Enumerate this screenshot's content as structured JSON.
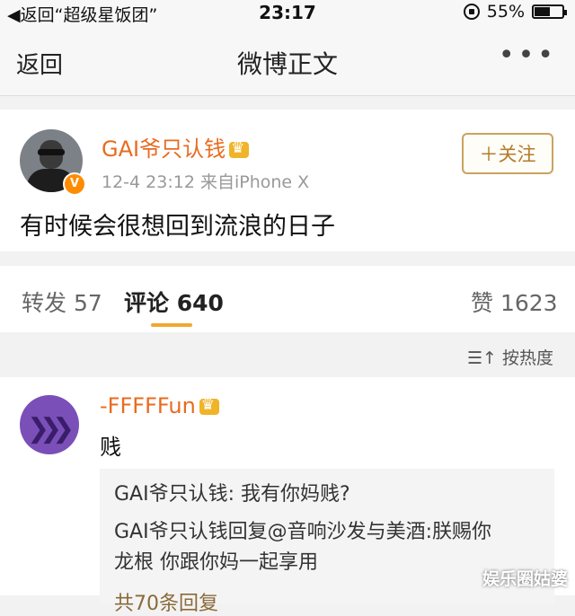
{
  "status_bar": {
    "back_app": "◀返回“超级星饭团”",
    "time": "23:17",
    "battery_percent": "55%",
    "battery_level": 0.55
  },
  "nav": {
    "back": "返回",
    "title": "微博正文",
    "more": "•••"
  },
  "post": {
    "username": "GAI爷只认钱",
    "timestamp": "12-4 23:12",
    "source": "来自iPhone X",
    "follow_label": "＋关注",
    "verified_badge": "V",
    "text": "有时候会很想回到流浪的日子"
  },
  "tabs": {
    "repost_label": "转发",
    "repost_count": "57",
    "comment_label": "评论",
    "comment_count": "640",
    "like_label": "赞",
    "like_count": "1623"
  },
  "sort": {
    "label": "按热度",
    "icon": "sort-icon"
  },
  "comment": {
    "username": "-FFFFFun",
    "text": "贱",
    "replies": [
      {
        "name": "GAI爷只认钱:",
        "text": " 我有你妈贱?"
      },
      {
        "name": "GAI爷只认钱回复@音响沙发与美酒:",
        "text": "朕赐你"
      },
      {
        "name": "",
        "text": "龙根  你跟你妈一起享用"
      }
    ],
    "more_replies": "共70条回复"
  },
  "watermark": "娱乐圈姑婆",
  "colors": {
    "username": "#e86b1f",
    "follow_border": "#c9a35f",
    "tab_underline": "#f0a830"
  }
}
